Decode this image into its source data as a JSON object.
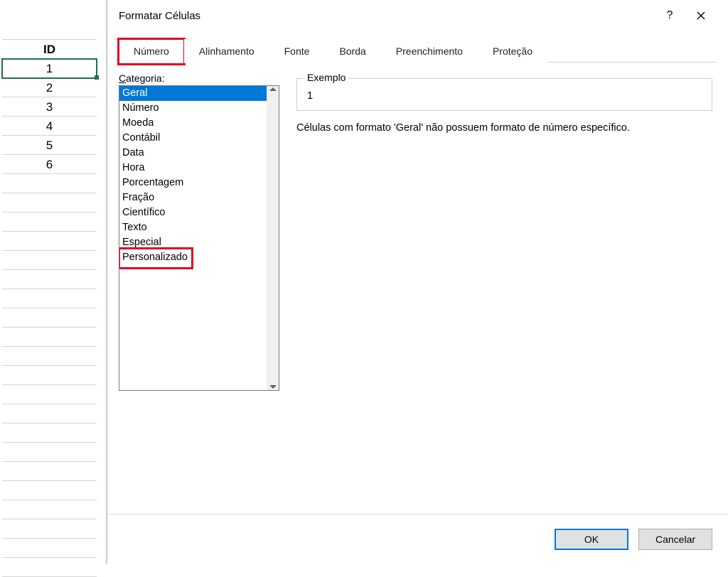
{
  "spreadsheet": {
    "header": "ID",
    "rows": [
      "1",
      "2",
      "3",
      "4",
      "5",
      "6"
    ],
    "selected_index": 0
  },
  "dialog": {
    "title": "Formatar Células",
    "tabs": [
      "Número",
      "Alinhamento",
      "Fonte",
      "Borda",
      "Preenchimento",
      "Proteção"
    ],
    "active_tab_index": 0,
    "category_label_prefix": "C",
    "category_label_rest": "ategoria:",
    "categories": [
      "Geral",
      "Número",
      "Moeda",
      "Contábil",
      "Data",
      "Hora",
      "Porcentagem",
      "Fração",
      "Científico",
      "Texto",
      "Especial",
      "Personalizado"
    ],
    "selected_category_index": 0,
    "highlighted_category_index": 11,
    "example_label": "Exemplo",
    "example_value": "1",
    "description": "Células com formato 'Geral' não possuem formato de número específico.",
    "buttons": {
      "ok": "OK",
      "cancel": "Cancelar"
    }
  }
}
